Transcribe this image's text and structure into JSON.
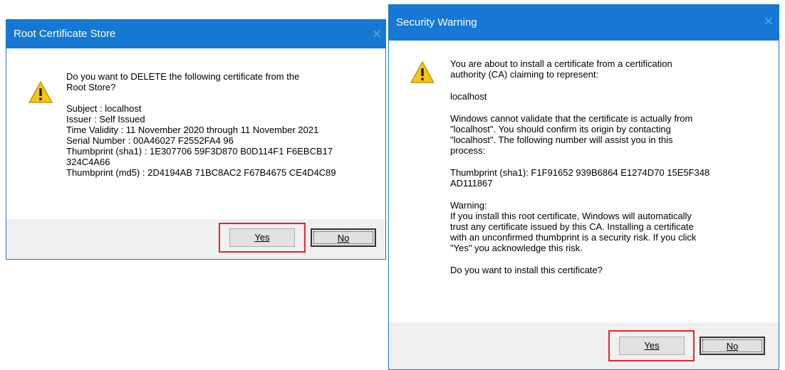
{
  "root_dialog": {
    "title": "Root Certificate Store",
    "question_line1": "Do you want to DELETE the following certificate from the",
    "question_line2": "Root Store?",
    "details": [
      "Subject : localhost",
      "Issuer : Self Issued",
      "Time Validity : 11 November 2020 through 11 November 2021",
      "Serial Number : 00A46027 F2552FA4 96",
      "Thumbprint (sha1) : 1E307706 59F3D870 B0D114F1 F6EBCB17",
      "324C4A66",
      "Thumbprint (md5) : 2D4194AB 71BC8AC2 F67B4675 CE4D4C89"
    ],
    "yes_label": "Yes",
    "no_label": "No"
  },
  "security_dialog": {
    "title": "Security Warning",
    "intro_line1": "You are about to install a certificate from a certification",
    "intro_line2": "authority (CA) claiming to represent:",
    "subject": "localhost",
    "validate_lines": [
      "Windows cannot validate that the certificate is actually from",
      "\"localhost\". You should confirm its origin by contacting",
      "\"localhost\". The following number will assist you in this",
      "process:"
    ],
    "thumbprint_lines": [
      "Thumbprint (sha1): F1F91652 939B6864 E1274D70 15E5F348",
      "AD111867"
    ],
    "warning_lines": [
      "Warning:",
      "If you install this root certificate, Windows will automatically",
      "trust any certificate issued by this CA. Installing a certificate",
      "with an unconfirmed thumbprint is a security risk. If you click",
      "\"Yes\" you acknowledge this risk."
    ],
    "question": "Do you want to install this certificate?",
    "yes_label": "Yes",
    "no_label": "No"
  },
  "colors": {
    "titlebar": "#1478d4",
    "highlight": "#e0282e"
  },
  "icons": {
    "warning": "warning-icon",
    "close": "close-icon"
  }
}
